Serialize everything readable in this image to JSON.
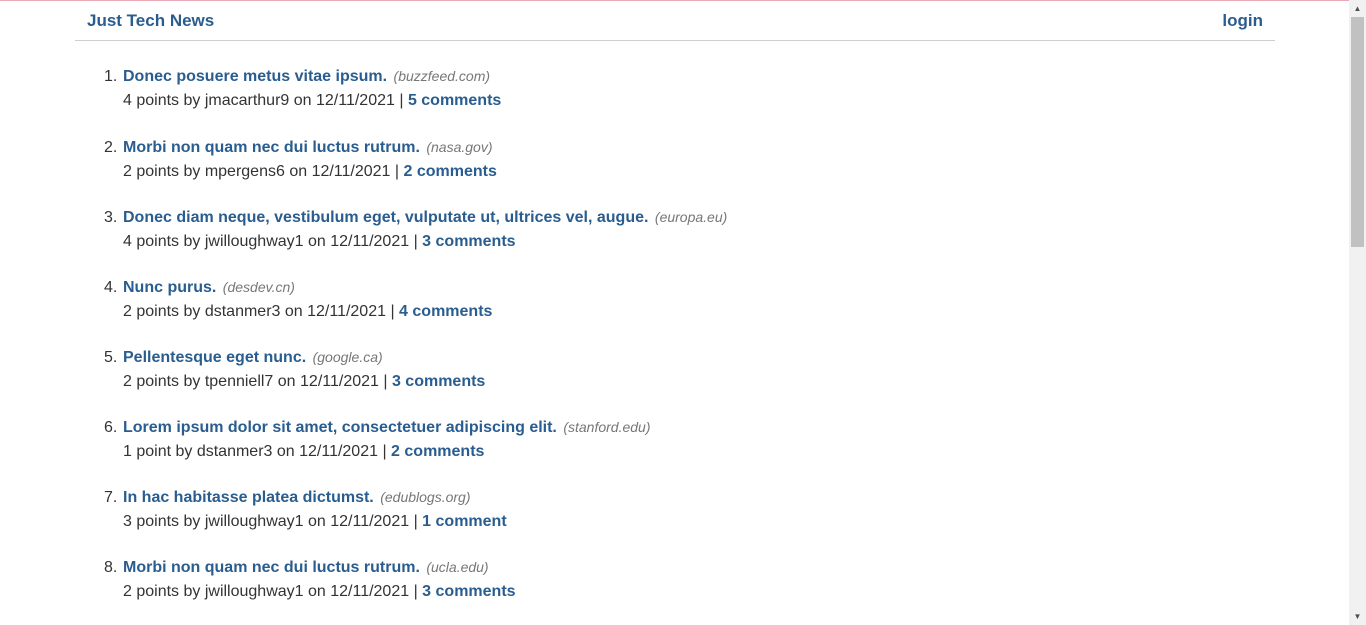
{
  "header": {
    "brand": "Just Tech News",
    "login": "login"
  },
  "posts": [
    {
      "num": "1.",
      "title": "Donec posuere metus vitae ipsum.",
      "domain": "(buzzfeed.com)",
      "meta": "4 points by jmacarthur9 on 12/11/2021 | ",
      "comments": "5 comments"
    },
    {
      "num": "2.",
      "title": "Morbi non quam nec dui luctus rutrum.",
      "domain": "(nasa.gov)",
      "meta": "2 points by mpergens6 on 12/11/2021 | ",
      "comments": "2 comments"
    },
    {
      "num": "3.",
      "title": "Donec diam neque, vestibulum eget, vulputate ut, ultrices vel, augue.",
      "domain": "(europa.eu)",
      "meta": "4 points by jwilloughway1 on 12/11/2021 | ",
      "comments": "3 comments"
    },
    {
      "num": "4.",
      "title": "Nunc purus.",
      "domain": "(desdev.cn)",
      "meta": "2 points by dstanmer3 on 12/11/2021 | ",
      "comments": "4 comments"
    },
    {
      "num": "5.",
      "title": "Pellentesque eget nunc.",
      "domain": "(google.ca)",
      "meta": "2 points by tpenniell7 on 12/11/2021 | ",
      "comments": "3 comments"
    },
    {
      "num": "6.",
      "title": "Lorem ipsum dolor sit amet, consectetuer adipiscing elit.",
      "domain": "(stanford.edu)",
      "meta": "1 point by dstanmer3 on 12/11/2021 | ",
      "comments": "2 comments"
    },
    {
      "num": "7.",
      "title": "In hac habitasse platea dictumst.",
      "domain": "(edublogs.org)",
      "meta": "3 points by jwilloughway1 on 12/11/2021 | ",
      "comments": "1 comment"
    },
    {
      "num": "8.",
      "title": "Morbi non quam nec dui luctus rutrum.",
      "domain": "(ucla.edu)",
      "meta": "2 points by jwilloughway1 on 12/11/2021 | ",
      "comments": "3 comments"
    }
  ]
}
